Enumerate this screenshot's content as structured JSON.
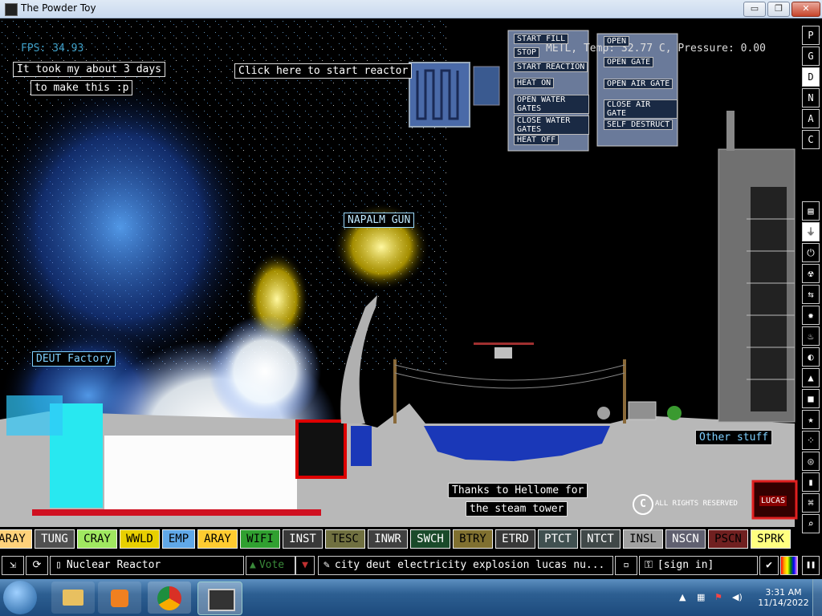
{
  "window": {
    "title": "The Powder Toy",
    "buttons": {
      "minimize": "▭",
      "maximize": "❐",
      "close": "✕"
    }
  },
  "hud": {
    "fps": "FPS: 34.93",
    "cursor_info": "METL, Temp: 32.77 C, Pressure: 0.00"
  },
  "labels": {
    "days": "It took my about 3 days",
    "days2": "to make this :p",
    "reactor": "Click here to start reactor",
    "napalm": "NAPALM GUN",
    "deut": "DEUT Factory",
    "other": "Other stuff",
    "thanks1": "Thanks to Hellome for",
    "thanks2": "the steam tower",
    "rights": "ALL RIGHTS RESERVED",
    "lucas": "LUCAS"
  },
  "reactor_panel": {
    "left_buttons": [
      "START FILL",
      "STOP",
      "START REACTION",
      "HEAT ON",
      "OPEN WATER GATES",
      "CLOSE WATER GATES",
      "HEAT OFF"
    ],
    "right_buttons": [
      "OPEN",
      "OPEN GATE",
      "OPEN AIR GATE",
      "CLOSE AIR GATE",
      "SELF DESTRUCT"
    ]
  },
  "right_toolbar": {
    "top": [
      "P",
      "G",
      "D",
      "N",
      "A",
      "C"
    ],
    "selected_top": "D",
    "icons": [
      "toolbar-menu-icon",
      "plug-icon",
      "power-icon",
      "radiation-icon",
      "sensor-icon",
      "explosive-icon",
      "gas-icon",
      "liquid-icon",
      "powder-icon",
      "solid-icon",
      "star-icon",
      "dots-icon",
      "life-icon",
      "bookmark-icon",
      "tools-icon",
      "search-icon"
    ]
  },
  "elements": [
    {
      "name": "ARAY",
      "color": "#ffd27a",
      "text": "#000"
    },
    {
      "name": "TUNG",
      "color": "#505050",
      "text": "#fff"
    },
    {
      "name": "CRAY",
      "color": "#a0e860",
      "text": "#000"
    },
    {
      "name": "WWLD",
      "color": "#e8d000",
      "text": "#000"
    },
    {
      "name": "EMP",
      "color": "#60a8e8",
      "text": "#000"
    },
    {
      "name": "ARAY",
      "color": "#ffcc30",
      "text": "#000"
    },
    {
      "name": "WIFI",
      "color": "#30a030",
      "text": "#000"
    },
    {
      "name": "INST",
      "color": "#383838",
      "text": "#fff"
    },
    {
      "name": "TESC",
      "color": "#707040",
      "text": "#000"
    },
    {
      "name": "INWR",
      "color": "#404040",
      "text": "#fff"
    },
    {
      "name": "SWCH",
      "color": "#1a4a2a",
      "text": "#fff"
    },
    {
      "name": "BTRY",
      "color": "#807030",
      "text": "#000"
    },
    {
      "name": "ETRD",
      "color": "#383838",
      "text": "#fff"
    },
    {
      "name": "PTCT",
      "color": "#405050",
      "text": "#fff"
    },
    {
      "name": "NTCT",
      "color": "#404848",
      "text": "#fff"
    },
    {
      "name": "INSL",
      "color": "#a0a0a0",
      "text": "#000"
    },
    {
      "name": "NSCN",
      "color": "#606070",
      "text": "#fff"
    },
    {
      "name": "PSCN",
      "color": "#702020",
      "text": "#000"
    },
    {
      "name": "SPRK",
      "color": "#ffff80",
      "text": "#000"
    }
  ],
  "bottom_bar": {
    "save_name": "Nuclear Reactor",
    "vote": "Vote",
    "tags": "city deut electricity explosion lucas nu...",
    "sign_in": "[sign in]"
  },
  "taskbar": {
    "time": "3:31 AM",
    "date": "11/14/2022",
    "apps": [
      "start-orb-icon",
      "file-explorer-icon",
      "media-player-icon",
      "chrome-icon",
      "powder-toy-icon"
    ]
  },
  "colors": {
    "water": "#1a38b8",
    "ground": "#b8b8b8",
    "deut": "#28e8f0",
    "fire": "#ffe040"
  }
}
